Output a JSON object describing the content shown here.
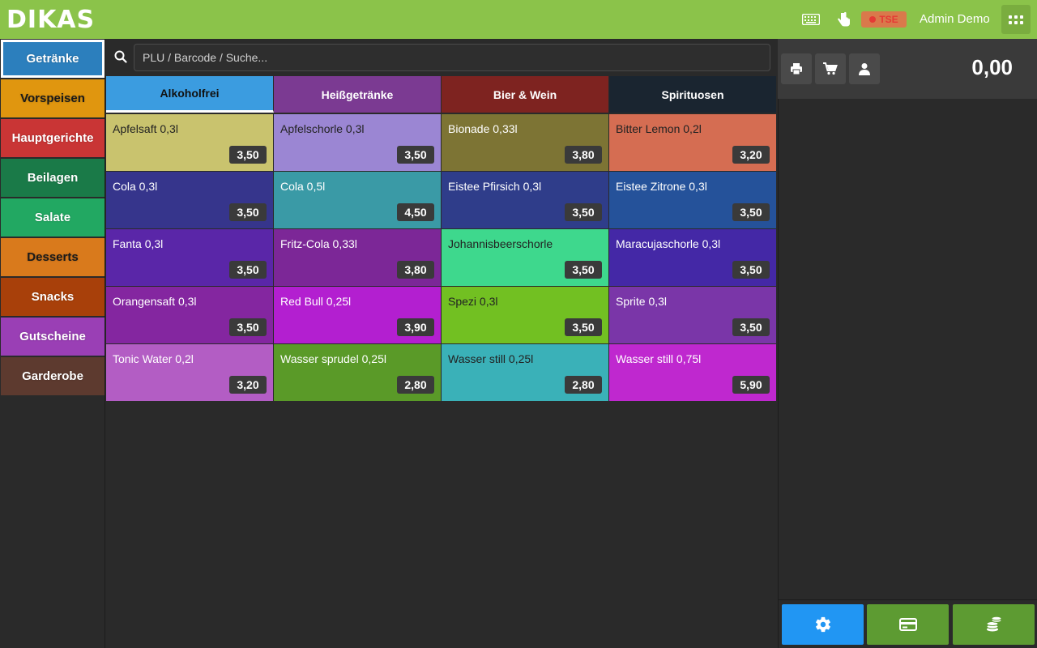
{
  "header": {
    "logo_text": "DIKAS",
    "keyboard_icon": "keyboard-icon",
    "touch_icon": "touch-hand-icon",
    "tse_label": "TSE",
    "user_name": "Admin Demo",
    "apps_icon": "apps-grid-icon",
    "background": "#8bc34a"
  },
  "search": {
    "icon": "search-icon",
    "placeholder": "PLU / Barcode / Suche..."
  },
  "categories": [
    {
      "label": "Getränke",
      "color": "#2c7fbd",
      "active": true
    },
    {
      "label": "Vorspeisen",
      "color": "#e0960f",
      "active": false
    },
    {
      "label": "Hauptgerichte",
      "color": "#c93535",
      "active": false
    },
    {
      "label": "Beilagen",
      "color": "#1a7a48",
      "active": false
    },
    {
      "label": "Salate",
      "color": "#22a862",
      "active": false
    },
    {
      "label": "Desserts",
      "color": "#d97a1c",
      "active": false
    },
    {
      "label": "Snacks",
      "color": "#a8400a",
      "active": false
    },
    {
      "label": "Gutscheine",
      "color": "#9a3fb5",
      "active": false
    },
    {
      "label": "Garderobe",
      "color": "#5d3a2f",
      "active": false
    }
  ],
  "tabs": [
    {
      "label": "Alkoholfrei",
      "color": "#3b9ce0",
      "active": true
    },
    {
      "label": "Heißgetränke",
      "color": "#7b3a92",
      "active": false
    },
    {
      "label": "Bier & Wein",
      "color": "#7e2320",
      "active": false
    },
    {
      "label": "Spirituosen",
      "color": "#1a2530",
      "active": false
    }
  ],
  "products": [
    {
      "name": "Apfelsaft 0,3l",
      "price": "3,50",
      "color": "#c9c36e",
      "text_color": "#222"
    },
    {
      "name": "Apfelschorle 0,3l",
      "price": "3,50",
      "color": "#9b86d3",
      "text_color": "#222"
    },
    {
      "name": "Bionade 0,33l",
      "price": "3,80",
      "color": "#7d7434",
      "text_color": "#fff"
    },
    {
      "name": "Bitter Lemon 0,2l",
      "price": "3,20",
      "color": "#d56d52",
      "text_color": "#222"
    },
    {
      "name": "Cola 0,3l",
      "price": "3,50",
      "color": "#36358c",
      "text_color": "#fff"
    },
    {
      "name": "Cola 0,5l",
      "price": "4,50",
      "color": "#3a9aa6",
      "text_color": "#fff"
    },
    {
      "name": "Eistee Pfirsich 0,3l",
      "price": "3,50",
      "color": "#2f3d8a",
      "text_color": "#fff"
    },
    {
      "name": "Eistee Zitrone 0,3l",
      "price": "3,50",
      "color": "#25529a",
      "text_color": "#fff"
    },
    {
      "name": "Fanta 0,3l",
      "price": "3,50",
      "color": "#5a26a8",
      "text_color": "#fff"
    },
    {
      "name": "Fritz-Cola 0,33l",
      "price": "3,80",
      "color": "#7c2797",
      "text_color": "#fff"
    },
    {
      "name": "Johannisbeerschorle",
      "price": "3,50",
      "color": "#3ed88d",
      "text_color": "#222"
    },
    {
      "name": "Maracujaschorle 0,3l",
      "price": "3,50",
      "color": "#4428a6",
      "text_color": "#fff"
    },
    {
      "name": "Orangensaft 0,3l",
      "price": "3,50",
      "color": "#8426a0",
      "text_color": "#fff"
    },
    {
      "name": "Red Bull 0,25l",
      "price": "3,90",
      "color": "#b31fd0",
      "text_color": "#fff"
    },
    {
      "name": "Spezi 0,3l",
      "price": "3,50",
      "color": "#72c022",
      "text_color": "#222"
    },
    {
      "name": "Sprite 0,3l",
      "price": "3,50",
      "color": "#7a36a8",
      "text_color": "#fff"
    },
    {
      "name": "Tonic Water 0,2l",
      "price": "3,20",
      "color": "#b35dc4",
      "text_color": "#fff"
    },
    {
      "name": "Wasser sprudel 0,25l",
      "price": "2,80",
      "color": "#5a9a28",
      "text_color": "#fff"
    },
    {
      "name": "Wasser still 0,25l",
      "price": "2,80",
      "color": "#3ab1b8",
      "text_color": "#222"
    },
    {
      "name": "Wasser still 0,75l",
      "price": "5,90",
      "color": "#bf28cf",
      "text_color": "#fff"
    }
  ],
  "cart": {
    "print_icon": "printer-icon",
    "cart_icon": "cart-icon",
    "customer_icon": "person-icon",
    "total": "0,00"
  },
  "actions": [
    {
      "icon": "gear-icon",
      "color": "#2196f3"
    },
    {
      "icon": "credit-card-icon",
      "color": "#5d9b32"
    },
    {
      "icon": "coins-icon",
      "color": "#5d9b32"
    }
  ]
}
